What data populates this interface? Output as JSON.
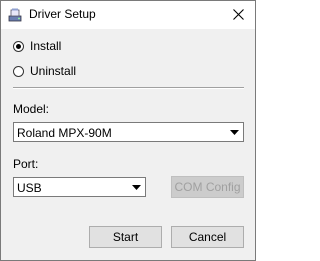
{
  "window": {
    "title": "Driver Setup"
  },
  "icons": {
    "app": "driver-setup-icon",
    "close": "close-icon",
    "dropdown": "chevron-down-icon"
  },
  "options": {
    "install_label": "Install",
    "uninstall_label": "Uninstall",
    "selected": "install"
  },
  "model": {
    "label": "Model:",
    "value": "Roland MPX-90M"
  },
  "port": {
    "label": "Port:",
    "value": "USB",
    "com_config_label": "COM Config",
    "com_config_enabled": false
  },
  "buttons": {
    "start": "Start",
    "cancel": "Cancel"
  }
}
